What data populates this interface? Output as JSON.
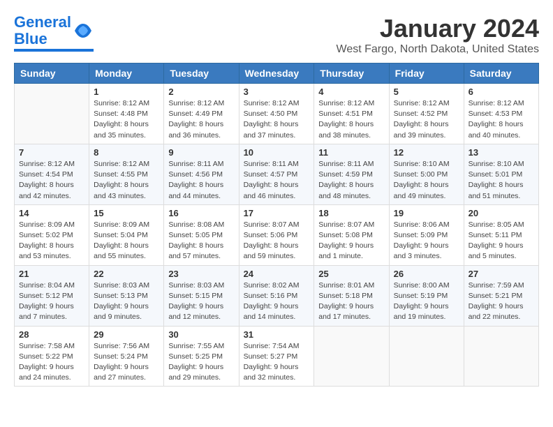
{
  "header": {
    "logo_line1": "General",
    "logo_line2": "Blue",
    "month_title": "January 2024",
    "location": "West Fargo, North Dakota, United States"
  },
  "weekdays": [
    "Sunday",
    "Monday",
    "Tuesday",
    "Wednesday",
    "Thursday",
    "Friday",
    "Saturday"
  ],
  "weeks": [
    [
      {
        "day": null,
        "info": null
      },
      {
        "day": "1",
        "sunrise": "8:12 AM",
        "sunset": "4:48 PM",
        "daylight": "8 hours and 35 minutes."
      },
      {
        "day": "2",
        "sunrise": "8:12 AM",
        "sunset": "4:49 PM",
        "daylight": "8 hours and 36 minutes."
      },
      {
        "day": "3",
        "sunrise": "8:12 AM",
        "sunset": "4:50 PM",
        "daylight": "8 hours and 37 minutes."
      },
      {
        "day": "4",
        "sunrise": "8:12 AM",
        "sunset": "4:51 PM",
        "daylight": "8 hours and 38 minutes."
      },
      {
        "day": "5",
        "sunrise": "8:12 AM",
        "sunset": "4:52 PM",
        "daylight": "8 hours and 39 minutes."
      },
      {
        "day": "6",
        "sunrise": "8:12 AM",
        "sunset": "4:53 PM",
        "daylight": "8 hours and 40 minutes."
      }
    ],
    [
      {
        "day": "7",
        "sunrise": "8:12 AM",
        "sunset": "4:54 PM",
        "daylight": "8 hours and 42 minutes."
      },
      {
        "day": "8",
        "sunrise": "8:12 AM",
        "sunset": "4:55 PM",
        "daylight": "8 hours and 43 minutes."
      },
      {
        "day": "9",
        "sunrise": "8:11 AM",
        "sunset": "4:56 PM",
        "daylight": "8 hours and 44 minutes."
      },
      {
        "day": "10",
        "sunrise": "8:11 AM",
        "sunset": "4:57 PM",
        "daylight": "8 hours and 46 minutes."
      },
      {
        "day": "11",
        "sunrise": "8:11 AM",
        "sunset": "4:59 PM",
        "daylight": "8 hours and 48 minutes."
      },
      {
        "day": "12",
        "sunrise": "8:10 AM",
        "sunset": "5:00 PM",
        "daylight": "8 hours and 49 minutes."
      },
      {
        "day": "13",
        "sunrise": "8:10 AM",
        "sunset": "5:01 PM",
        "daylight": "8 hours and 51 minutes."
      }
    ],
    [
      {
        "day": "14",
        "sunrise": "8:09 AM",
        "sunset": "5:02 PM",
        "daylight": "8 hours and 53 minutes."
      },
      {
        "day": "15",
        "sunrise": "8:09 AM",
        "sunset": "5:04 PM",
        "daylight": "8 hours and 55 minutes."
      },
      {
        "day": "16",
        "sunrise": "8:08 AM",
        "sunset": "5:05 PM",
        "daylight": "8 hours and 57 minutes."
      },
      {
        "day": "17",
        "sunrise": "8:07 AM",
        "sunset": "5:06 PM",
        "daylight": "8 hours and 59 minutes."
      },
      {
        "day": "18",
        "sunrise": "8:07 AM",
        "sunset": "5:08 PM",
        "daylight": "9 hours and 1 minute."
      },
      {
        "day": "19",
        "sunrise": "8:06 AM",
        "sunset": "5:09 PM",
        "daylight": "9 hours and 3 minutes."
      },
      {
        "day": "20",
        "sunrise": "8:05 AM",
        "sunset": "5:11 PM",
        "daylight": "9 hours and 5 minutes."
      }
    ],
    [
      {
        "day": "21",
        "sunrise": "8:04 AM",
        "sunset": "5:12 PM",
        "daylight": "9 hours and 7 minutes."
      },
      {
        "day": "22",
        "sunrise": "8:03 AM",
        "sunset": "5:13 PM",
        "daylight": "9 hours and 9 minutes."
      },
      {
        "day": "23",
        "sunrise": "8:03 AM",
        "sunset": "5:15 PM",
        "daylight": "9 hours and 12 minutes."
      },
      {
        "day": "24",
        "sunrise": "8:02 AM",
        "sunset": "5:16 PM",
        "daylight": "9 hours and 14 minutes."
      },
      {
        "day": "25",
        "sunrise": "8:01 AM",
        "sunset": "5:18 PM",
        "daylight": "9 hours and 17 minutes."
      },
      {
        "day": "26",
        "sunrise": "8:00 AM",
        "sunset": "5:19 PM",
        "daylight": "9 hours and 19 minutes."
      },
      {
        "day": "27",
        "sunrise": "7:59 AM",
        "sunset": "5:21 PM",
        "daylight": "9 hours and 22 minutes."
      }
    ],
    [
      {
        "day": "28",
        "sunrise": "7:58 AM",
        "sunset": "5:22 PM",
        "daylight": "9 hours and 24 minutes."
      },
      {
        "day": "29",
        "sunrise": "7:56 AM",
        "sunset": "5:24 PM",
        "daylight": "9 hours and 27 minutes."
      },
      {
        "day": "30",
        "sunrise": "7:55 AM",
        "sunset": "5:25 PM",
        "daylight": "9 hours and 29 minutes."
      },
      {
        "day": "31",
        "sunrise": "7:54 AM",
        "sunset": "5:27 PM",
        "daylight": "9 hours and 32 minutes."
      },
      {
        "day": null,
        "info": null
      },
      {
        "day": null,
        "info": null
      },
      {
        "day": null,
        "info": null
      }
    ]
  ],
  "labels": {
    "sunrise": "Sunrise:",
    "sunset": "Sunset:",
    "daylight": "Daylight:"
  }
}
